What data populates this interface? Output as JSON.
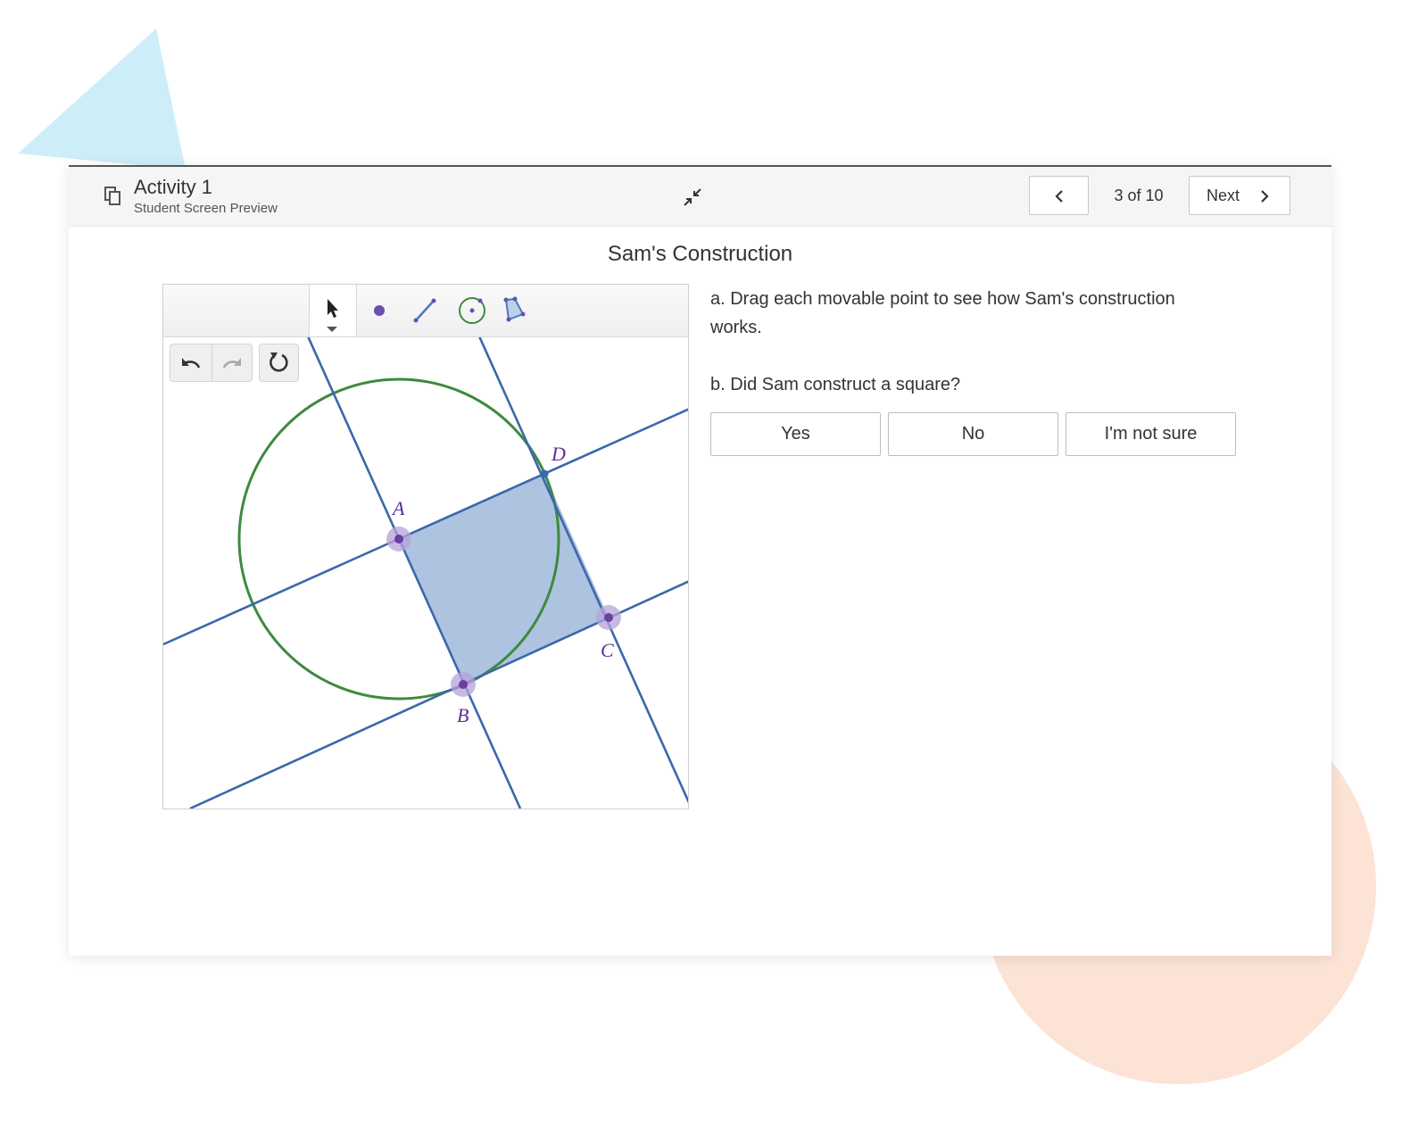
{
  "header": {
    "title": "Activity 1",
    "subtitle": "Student Screen Preview",
    "page_indicator": "3 of 10",
    "next_label": "Next"
  },
  "screen": {
    "title": "Sam's Construction",
    "prompt_a": "a. Drag each movable point to see how Sam's construction works.",
    "prompt_b": "b. Did Sam construct a square?",
    "choices": [
      "Yes",
      "No",
      "I'm not sure"
    ]
  },
  "graph": {
    "point_labels": {
      "A": "A",
      "B": "B",
      "C": "C",
      "D": "D"
    },
    "tools": [
      "select-icon",
      "point-icon",
      "segment-icon",
      "circle-icon",
      "polygon-icon"
    ],
    "colors": {
      "line": "#3b67ad",
      "circle": "#3e8a3e",
      "fill": "#aec3e0",
      "point": "#6a3fa0",
      "point_halo": "#b7a3d9"
    }
  },
  "decor": {
    "triangle_color": "#cdeef9",
    "circle_color": "#fce3d6"
  }
}
